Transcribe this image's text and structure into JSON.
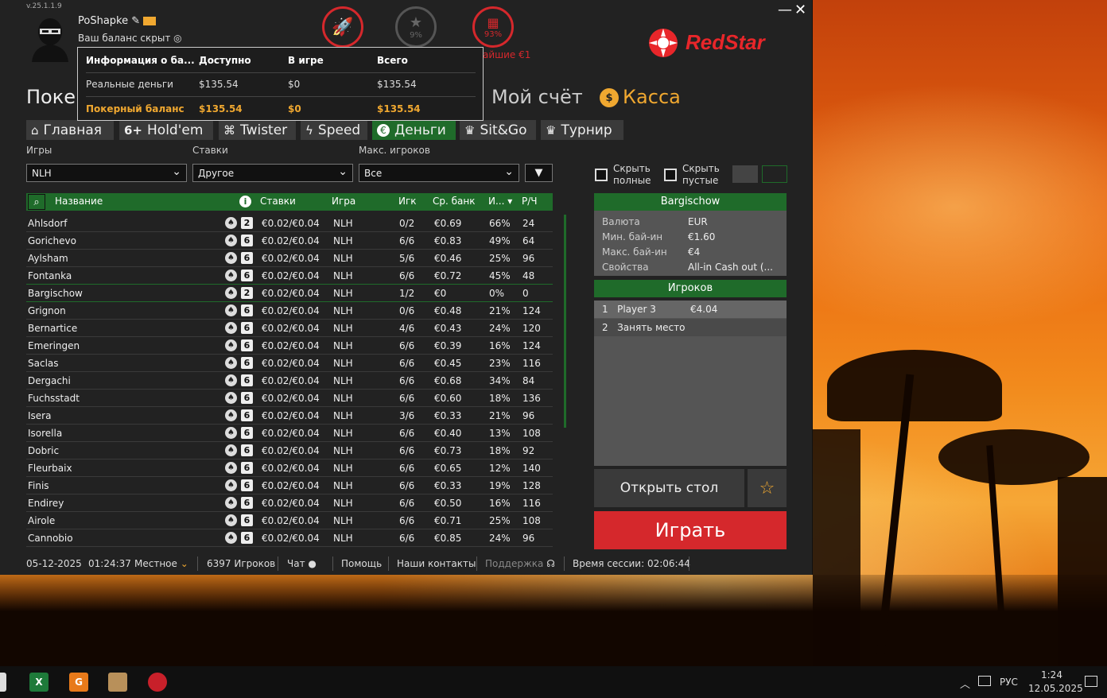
{
  "app": {
    "version": "v.25.1.1.9",
    "username": "PoShapke",
    "balance_hidden": "Ваш баланс скрыт",
    "top_icons": {
      "rocket": "",
      "star_pct": "9%",
      "gift_pct": "93%",
      "nearest": "айшие €1"
    },
    "logo": "RedStar",
    "minimize": "—",
    "close": "✕"
  },
  "nav": {
    "poker": "Покер",
    "account": "Мой счёт",
    "cashier": "Касса"
  },
  "tabs": [
    {
      "label": "Главная",
      "icon": "⌂"
    },
    {
      "label": "Hold'em",
      "icon": "6+"
    },
    {
      "label": "Twister",
      "icon": "⌘"
    },
    {
      "label": "Speed",
      "icon": "ϟ"
    },
    {
      "label": "Деньги",
      "icon": "€"
    },
    {
      "label": "Sit&Go",
      "icon": "♛"
    },
    {
      "label": "Турнир",
      "icon": "♛"
    }
  ],
  "filters": {
    "games_label": "Игры",
    "games_value": "NLH",
    "stakes_label": "Ставки",
    "stakes_value": "Другое",
    "max_label": "Макс. игроков",
    "max_value": "Все",
    "hide_full": "Скрыть полные",
    "hide_empty": "Скрыть пустые"
  },
  "table": {
    "headers": {
      "name": "Название",
      "stakes": "Ставки",
      "game": "Игра",
      "players": "Игк",
      "avg_bank": "Ср. банк",
      "pct": "И...",
      "ph": "Р/Ч"
    },
    "rows": [
      {
        "name": "Ahlsdorf",
        "seats": "2",
        "stakes": "€0.02/€0.04",
        "game": "NLH",
        "players": "0/2",
        "avg": "€0.69",
        "pct": "66%",
        "ph": "24"
      },
      {
        "name": "Gorichevo",
        "seats": "6",
        "stakes": "€0.02/€0.04",
        "game": "NLH",
        "players": "6/6",
        "avg": "€0.83",
        "pct": "49%",
        "ph": "64"
      },
      {
        "name": "Aylsham",
        "seats": "6",
        "stakes": "€0.02/€0.04",
        "game": "NLH",
        "players": "5/6",
        "avg": "€0.46",
        "pct": "25%",
        "ph": "96"
      },
      {
        "name": "Fontanka",
        "seats": "6",
        "stakes": "€0.02/€0.04",
        "game": "NLH",
        "players": "6/6",
        "avg": "€0.72",
        "pct": "45%",
        "ph": "48"
      },
      {
        "name": "Bargischow",
        "seats": "2",
        "stakes": "€0.02/€0.04",
        "game": "NLH",
        "players": "1/2",
        "avg": "€0",
        "pct": "0%",
        "ph": "0"
      },
      {
        "name": "Grignon",
        "seats": "6",
        "stakes": "€0.02/€0.04",
        "game": "NLH",
        "players": "0/6",
        "avg": "€0.48",
        "pct": "21%",
        "ph": "124"
      },
      {
        "name": "Bernartice",
        "seats": "6",
        "stakes": "€0.02/€0.04",
        "game": "NLH",
        "players": "4/6",
        "avg": "€0.43",
        "pct": "24%",
        "ph": "120"
      },
      {
        "name": "Emeringen",
        "seats": "6",
        "stakes": "€0.02/€0.04",
        "game": "NLH",
        "players": "6/6",
        "avg": "€0.39",
        "pct": "16%",
        "ph": "124"
      },
      {
        "name": "Saclas",
        "seats": "6",
        "stakes": "€0.02/€0.04",
        "game": "NLH",
        "players": "6/6",
        "avg": "€0.45",
        "pct": "23%",
        "ph": "116"
      },
      {
        "name": "Dergachi",
        "seats": "6",
        "stakes": "€0.02/€0.04",
        "game": "NLH",
        "players": "6/6",
        "avg": "€0.68",
        "pct": "34%",
        "ph": "84"
      },
      {
        "name": "Fuchsstadt",
        "seats": "6",
        "stakes": "€0.02/€0.04",
        "game": "NLH",
        "players": "6/6",
        "avg": "€0.60",
        "pct": "18%",
        "ph": "136"
      },
      {
        "name": "Isera",
        "seats": "6",
        "stakes": "€0.02/€0.04",
        "game": "NLH",
        "players": "3/6",
        "avg": "€0.33",
        "pct": "21%",
        "ph": "96"
      },
      {
        "name": "Isorella",
        "seats": "6",
        "stakes": "€0.02/€0.04",
        "game": "NLH",
        "players": "6/6",
        "avg": "€0.40",
        "pct": "13%",
        "ph": "108"
      },
      {
        "name": "Dobric",
        "seats": "6",
        "stakes": "€0.02/€0.04",
        "game": "NLH",
        "players": "6/6",
        "avg": "€0.73",
        "pct": "18%",
        "ph": "92"
      },
      {
        "name": "Fleurbaix",
        "seats": "6",
        "stakes": "€0.02/€0.04",
        "game": "NLH",
        "players": "6/6",
        "avg": "€0.65",
        "pct": "12%",
        "ph": "140"
      },
      {
        "name": "Finis",
        "seats": "6",
        "stakes": "€0.02/€0.04",
        "game": "NLH",
        "players": "6/6",
        "avg": "€0.33",
        "pct": "19%",
        "ph": "128"
      },
      {
        "name": "Endirey",
        "seats": "6",
        "stakes": "€0.02/€0.04",
        "game": "NLH",
        "players": "6/6",
        "avg": "€0.50",
        "pct": "16%",
        "ph": "116"
      },
      {
        "name": "Airole",
        "seats": "6",
        "stakes": "€0.02/€0.04",
        "game": "NLH",
        "players": "6/6",
        "avg": "€0.71",
        "pct": "25%",
        "ph": "108"
      },
      {
        "name": "Cannobio",
        "seats": "6",
        "stakes": "€0.02/€0.04",
        "game": "NLH",
        "players": "6/6",
        "avg": "€0.85",
        "pct": "24%",
        "ph": "96"
      }
    ]
  },
  "info_panel": {
    "title": "Bargischow",
    "currency_k": "Валюта",
    "currency_v": "EUR",
    "minbuy_k": "Мин. бай-ин",
    "minbuy_v": "€1.60",
    "maxbuy_k": "Макс. бай-ин",
    "maxbuy_v": "€4",
    "props_k": "Свойства",
    "props_v": "All-in Cash out (...",
    "players_title": "Игроков",
    "players": [
      {
        "n": "1",
        "name": "Player 3",
        "amount": "€4.04"
      },
      {
        "n": "2",
        "name": "Занять место",
        "amount": ""
      }
    ],
    "open_table": "Открыть стол",
    "play": "Играть"
  },
  "popup": {
    "h_info": "Информация о ба...",
    "h_avail": "Доступно",
    "h_ingame": "В игре",
    "h_total": "Всего",
    "r1": [
      "Реальные деньги",
      "$135.54",
      "$0",
      "$135.54"
    ],
    "r2": [
      "Покерный баланс",
      "$135.54",
      "$0",
      "$135.54"
    ]
  },
  "status": {
    "date": "05-12-2025",
    "time": "01:24:37",
    "local": "Местное",
    "players": "6397 Игроков",
    "chat": "Чат",
    "help": "Помощь",
    "contacts": "Наши контакты",
    "support": "Поддержка",
    "session": "Время сессии: 02:06:44"
  },
  "taskbar": {
    "lang": "РУС",
    "time": "1:24",
    "date": "12.05.2025"
  },
  "colors": {
    "accent_green": "#1f6b2a",
    "brand_red": "#d5282c",
    "gold": "#f0a830"
  }
}
